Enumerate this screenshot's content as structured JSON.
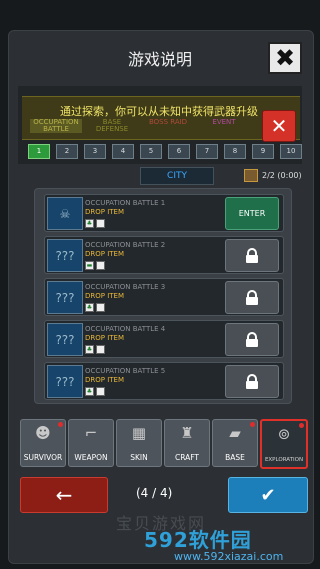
{
  "dialog": {
    "title": "游戏说明"
  },
  "banner": {
    "text": "通过探索，你可以从未知中获得武器升级",
    "bg_tabs": [
      "OCCUPATION BATTLE",
      "BASE DEFENSE",
      "BOSS RAID",
      "EVENT"
    ]
  },
  "pages": [
    "1",
    "2",
    "3",
    "4",
    "5",
    "6",
    "7",
    "8",
    "9",
    "10"
  ],
  "active_page": "1",
  "location": {
    "name": "CITY",
    "progress": "2/2 (0:00)"
  },
  "battles": [
    {
      "name": "OCCUPATION BATTLE 1",
      "drop": "DROP ITEM",
      "status": "enter",
      "enter_label": "ENTER"
    },
    {
      "name": "OCCUPATION BATTLE 2",
      "drop": "DROP ITEM",
      "status": "locked"
    },
    {
      "name": "OCCUPATION BATTLE 3",
      "drop": "DROP ITEM",
      "status": "locked"
    },
    {
      "name": "OCCUPATION BATTLE 4",
      "drop": "DROP ITEM",
      "status": "locked"
    },
    {
      "name": "OCCUPATION BATTLE 5",
      "drop": "DROP ITEM",
      "status": "locked"
    }
  ],
  "tabs": [
    {
      "label": "SURVIVOR",
      "icon": "survivor-icon",
      "glyph": "☻",
      "dot": true
    },
    {
      "label": "WEAPON",
      "icon": "weapon-icon",
      "glyph": "⌐",
      "dot": false
    },
    {
      "label": "SKIN",
      "icon": "skin-icon",
      "glyph": "▦",
      "dot": false
    },
    {
      "label": "CRAFT",
      "icon": "craft-icon",
      "glyph": "♜",
      "dot": false
    },
    {
      "label": "BASE",
      "icon": "base-icon",
      "glyph": "▰",
      "dot": true
    },
    {
      "label": "EXPLORATION",
      "icon": "exploration-icon",
      "glyph": "⊚",
      "dot": true,
      "active": true
    }
  ],
  "pager": {
    "indicator": "(4 / 4)"
  },
  "watermark": {
    "main": "592软件园",
    "url": "www.592xiazai.com",
    "ghost": "宝贝游戏网"
  },
  "colors": {
    "accent_green": "#2d9a3c",
    "drop_gold": "#e7b739",
    "city_blue": "#39a9ff",
    "alert_red": "#d43228"
  }
}
